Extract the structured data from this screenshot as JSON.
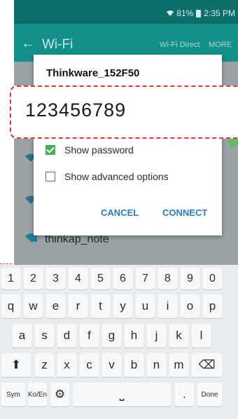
{
  "status_bar": {
    "battery_percent": "81%",
    "time": "2:35 PM"
  },
  "action_bar": {
    "title": "Wi-Fi",
    "wifi_direct": "Wi-Fi Direct",
    "more": "MORE"
  },
  "background_list": {
    "visible_network": "thinkap_note"
  },
  "dialog": {
    "network_name": "Thinkware_152F50",
    "show_password_label": "Show password",
    "show_password_checked": true,
    "advanced_label": "Show advanced options",
    "advanced_checked": false,
    "cancel_label": "CANCEL",
    "connect_label": "CONNECT"
  },
  "password_callout": {
    "value": "123456789",
    "border_color": "#e03a2f"
  },
  "keyboard": {
    "number_row": [
      "1",
      "2",
      "3",
      "4",
      "5",
      "6",
      "7",
      "8",
      "9",
      "0"
    ],
    "row1": [
      "q",
      "w",
      "e",
      "r",
      "t",
      "y",
      "u",
      "i",
      "o",
      "p"
    ],
    "row2": [
      "a",
      "s",
      "d",
      "f",
      "g",
      "h",
      "j",
      "k",
      "l"
    ],
    "row3": [
      "z",
      "x",
      "c",
      "v",
      "b",
      "n",
      "m"
    ],
    "sym_label": "Sym",
    "lang_label_top": "Ko",
    "lang_label_bottom": "En",
    "done_label": "Done",
    "period_label": "."
  },
  "colors": {
    "statusbar": "#0c6f69",
    "actionbar": "#14908a",
    "accent_green": "#43b059",
    "button_blue": "#2a7db7"
  },
  "icons": [
    "back-arrow-icon",
    "wifi-signal-icon",
    "battery-icon",
    "shift-icon",
    "backspace-icon",
    "settings-gear-icon",
    "space-icon"
  ]
}
